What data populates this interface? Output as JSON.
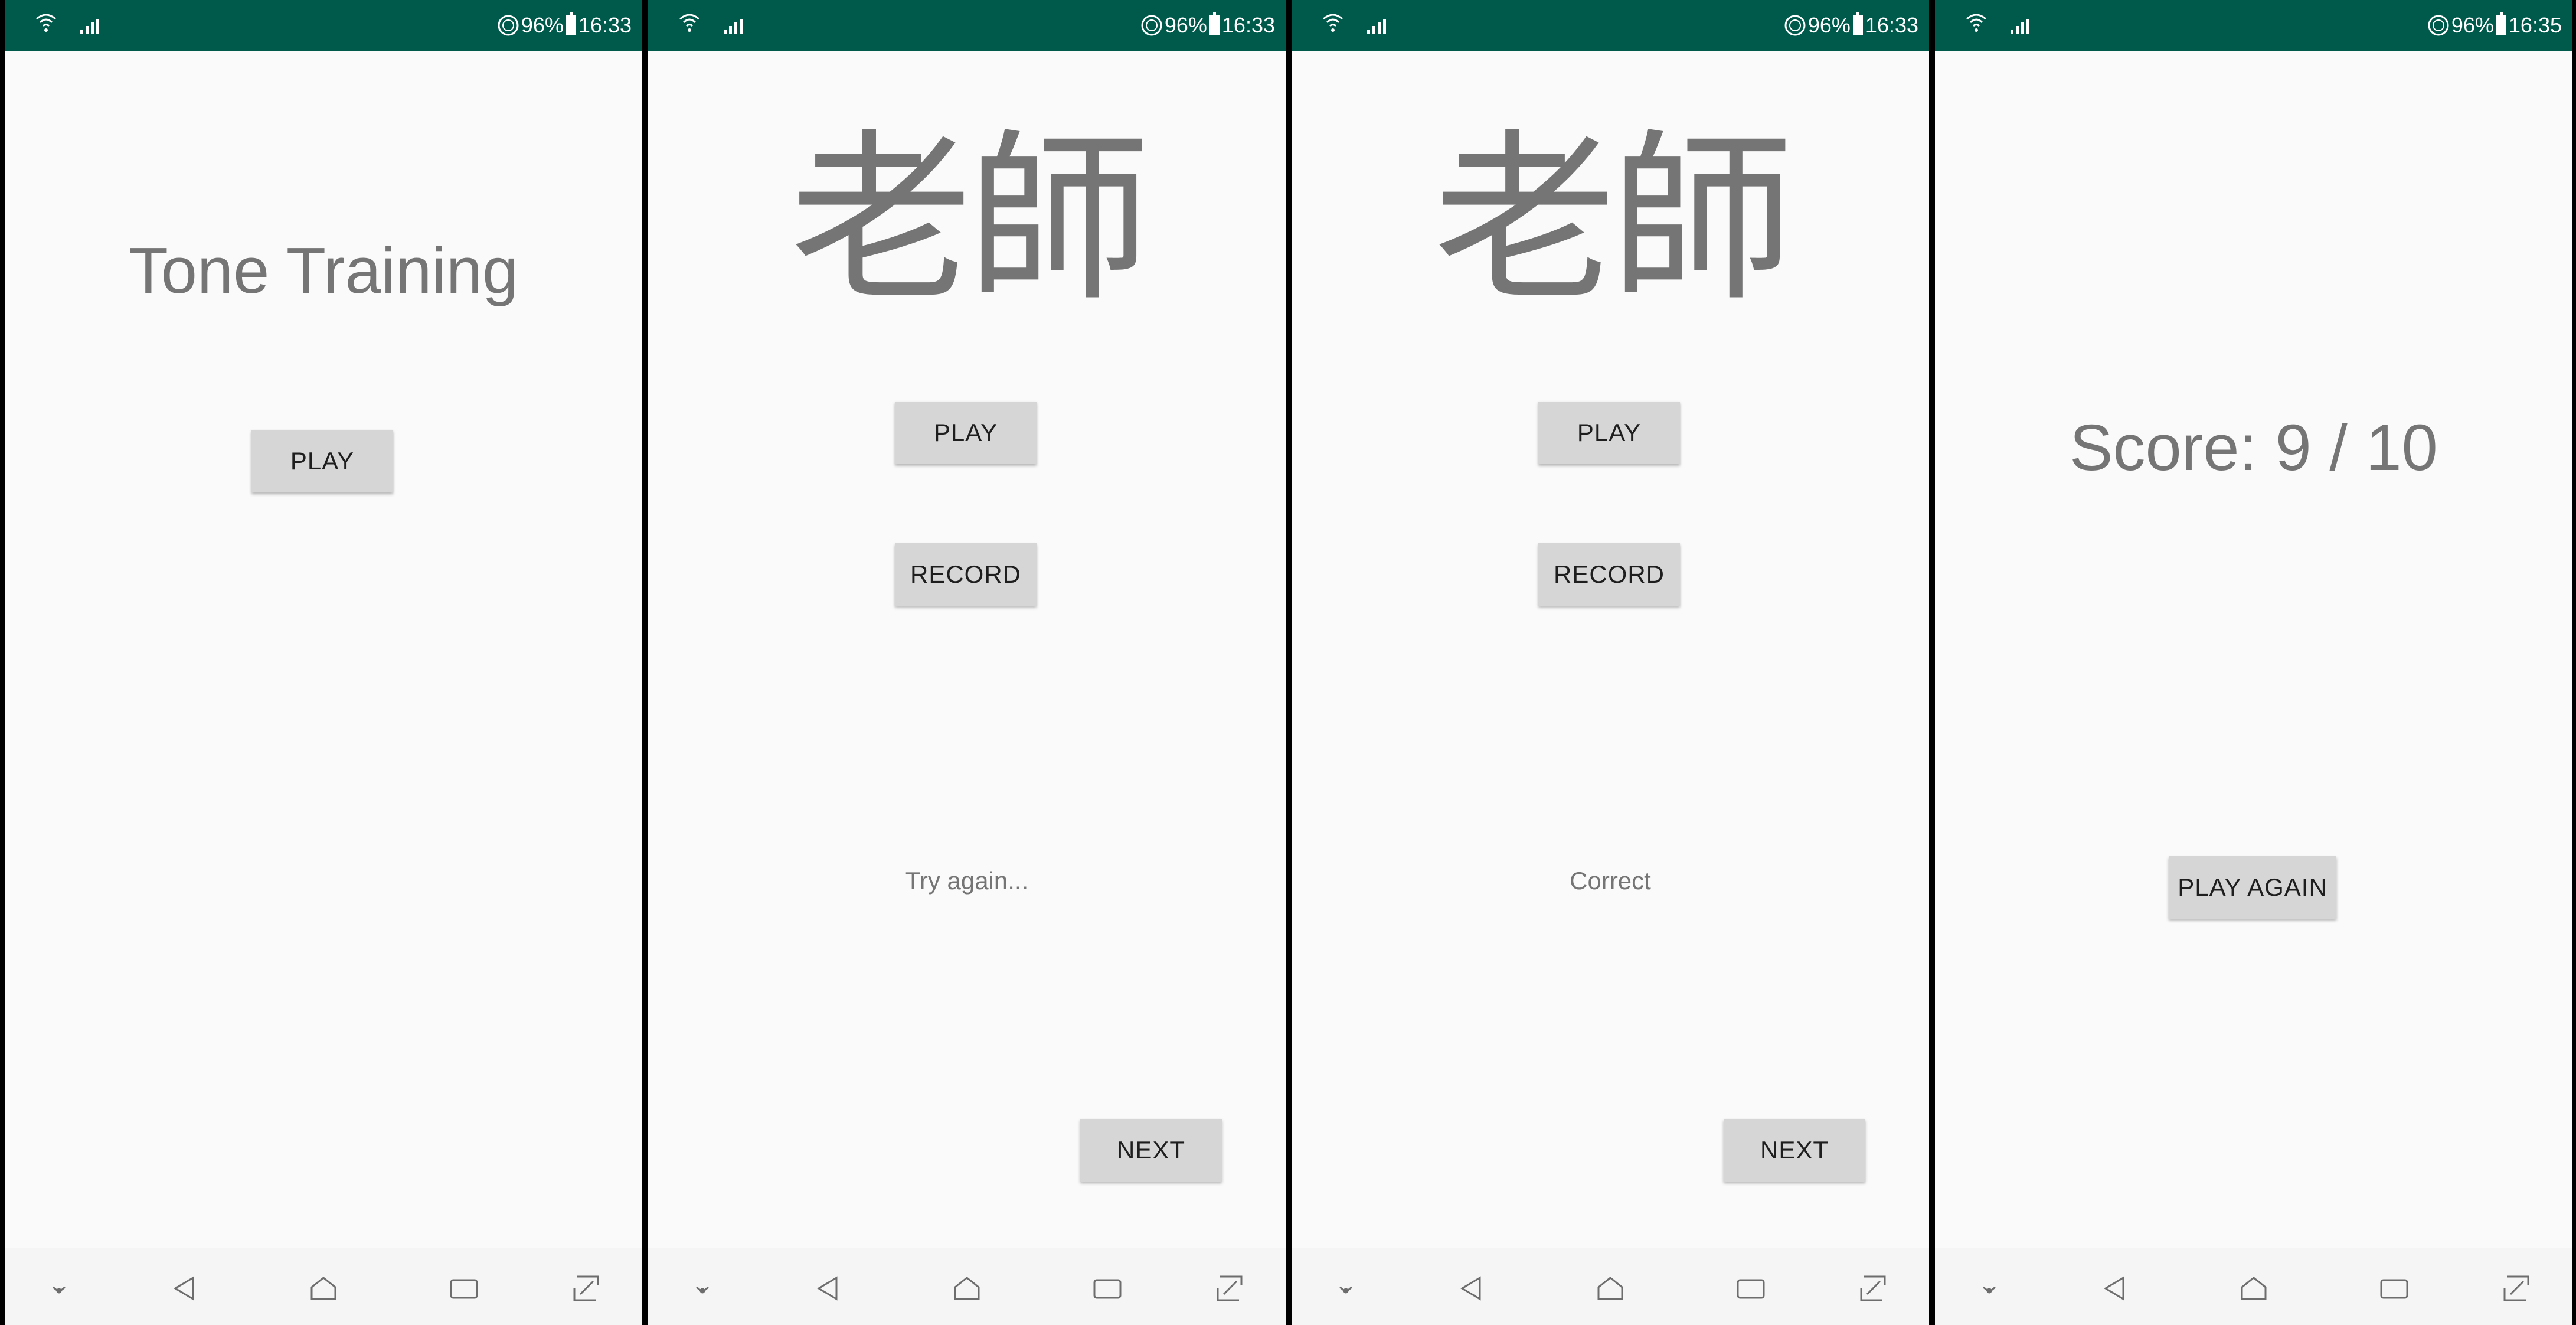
{
  "screens": [
    {
      "status": {
        "battery": "96%",
        "time": "16:33"
      },
      "title": "Tone Training",
      "buttons": {
        "play": "PLAY"
      }
    },
    {
      "status": {
        "battery": "96%",
        "time": "16:33"
      },
      "character": "老師",
      "buttons": {
        "play": "PLAY",
        "record": "RECORD",
        "next": "NEXT"
      },
      "feedback": "Try again..."
    },
    {
      "status": {
        "battery": "96%",
        "time": "16:33"
      },
      "character": "老師",
      "buttons": {
        "play": "PLAY",
        "record": "RECORD",
        "next": "NEXT"
      },
      "feedback": "Correct"
    },
    {
      "status": {
        "battery": "96%",
        "time": "16:35"
      },
      "score": "Score: 9 / 10",
      "buttons": {
        "play_again": "PLAY AGAIN"
      }
    }
  ],
  "colors": {
    "status_bar": "#005a4c",
    "background": "#fafafa",
    "button": "#d6d6d6",
    "text_gray": "#757575"
  },
  "icons": {
    "status": [
      "wifi-icon",
      "signal-icon",
      "sync-icon",
      "battery-icon"
    ],
    "nav": [
      "hide-nav-icon",
      "back-icon",
      "home-icon",
      "recents-icon",
      "screenshot-icon"
    ]
  }
}
